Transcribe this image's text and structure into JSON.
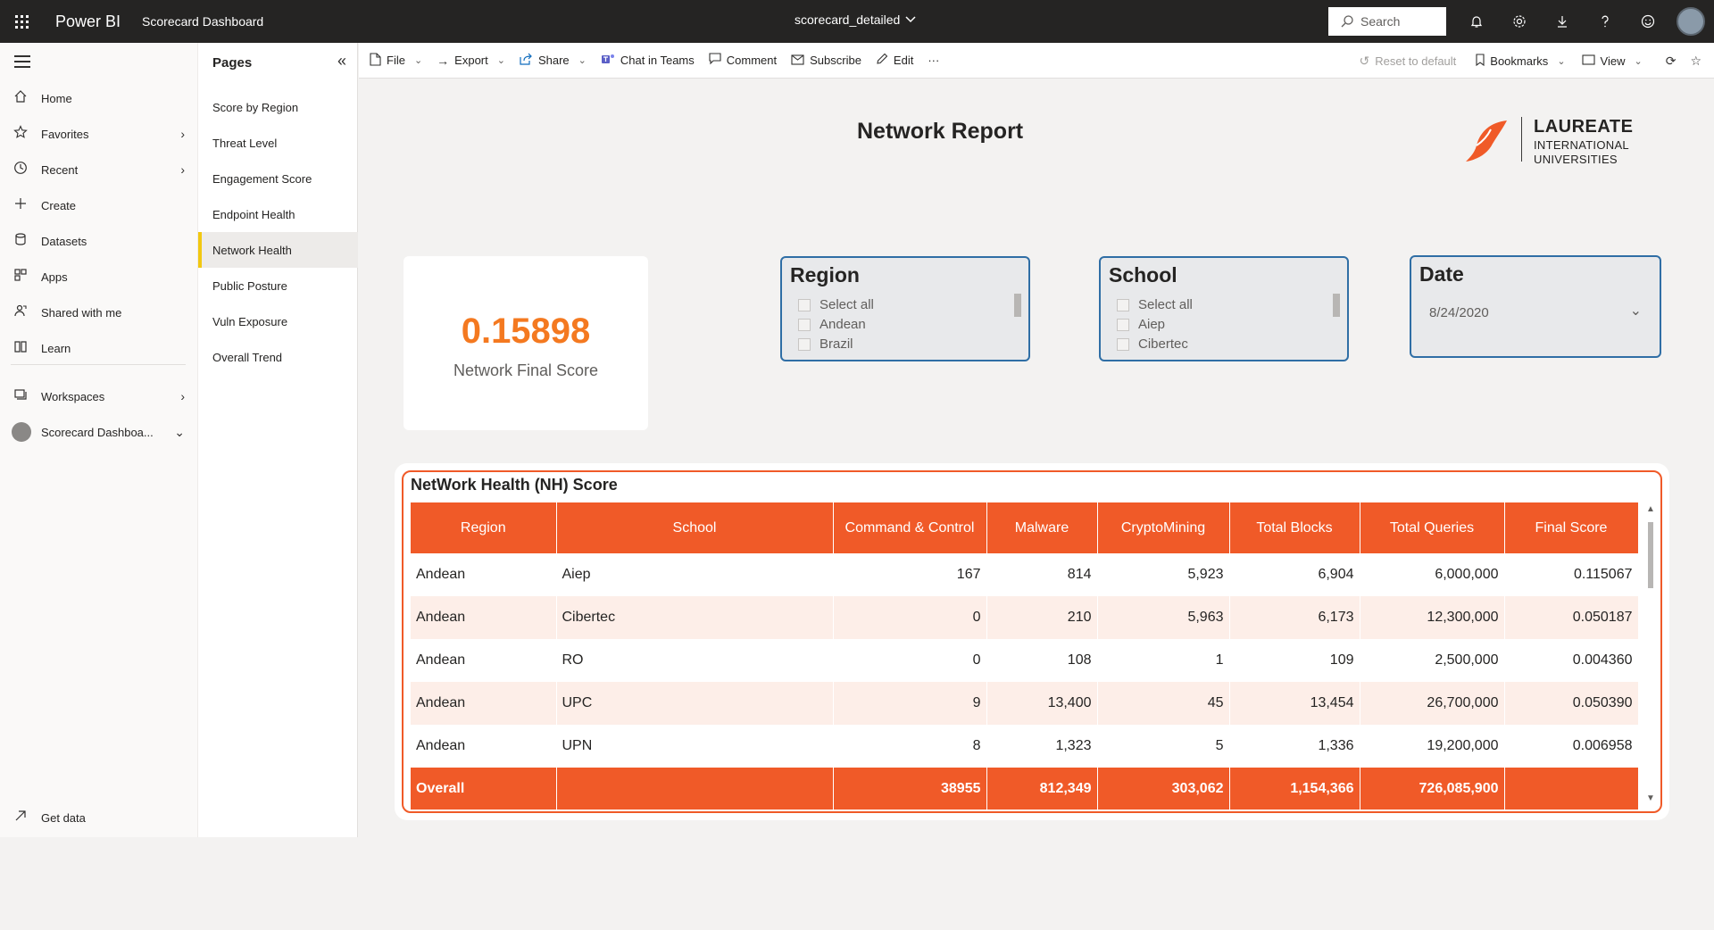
{
  "topbar": {
    "brand": "Power BI",
    "workspace": "Scorecard Dashboard",
    "report_name": "scorecard_detailed",
    "search_placeholder": "Search"
  },
  "leftnav": {
    "items": [
      {
        "label": "Home",
        "icon": "home-icon"
      },
      {
        "label": "Favorites",
        "icon": "star-icon"
      },
      {
        "label": "Recent",
        "icon": "clock-icon"
      },
      {
        "label": "Create",
        "icon": "plus-icon"
      },
      {
        "label": "Datasets",
        "icon": "database-icon"
      },
      {
        "label": "Apps",
        "icon": "apps-icon"
      },
      {
        "label": "Shared with me",
        "icon": "shared-icon"
      },
      {
        "label": "Learn",
        "icon": "book-icon"
      },
      {
        "label": "Workspaces",
        "icon": "workspaces-icon"
      },
      {
        "label": "Scorecard Dashboa...",
        "icon": "workspace-avatar"
      }
    ],
    "get_data": "Get data"
  },
  "pages": {
    "title": "Pages",
    "items": [
      "Score by Region",
      "Threat Level",
      "Engagement Score",
      "Endpoint Health",
      "Network Health",
      "Public Posture",
      "Vuln Exposure",
      "Overall Trend"
    ],
    "active": "Network Health"
  },
  "actionbar": {
    "file": "File",
    "export": "Export",
    "share": "Share",
    "chat": "Chat in Teams",
    "comment": "Comment",
    "subscribe": "Subscribe",
    "edit": "Edit",
    "more": "···",
    "reset": "Reset to default",
    "bookmarks": "Bookmarks",
    "view": "View"
  },
  "report": {
    "title": "Network Report",
    "logo": {
      "line1": "LAUREATE",
      "line2": "INTERNATIONAL",
      "line3": "UNIVERSITIES"
    },
    "kpi": {
      "value": "0.15898",
      "label": "Network Final Score"
    },
    "region_slicer": {
      "title": "Region",
      "options": [
        "Select all",
        "Andean",
        "Brazil"
      ]
    },
    "school_slicer": {
      "title": "School",
      "options": [
        "Select all",
        "Aiep",
        "Cibertec"
      ]
    },
    "date_slicer": {
      "title": "Date",
      "value": "8/24/2020"
    },
    "table": {
      "title": "NetWork Health (NH) Score",
      "columns": [
        "Region",
        "School",
        "Command & Control",
        "Malware",
        "CryptoMining",
        "Total Blocks",
        "Total Queries",
        "Final Score"
      ],
      "rows": [
        [
          "Andean",
          "Aiep",
          "167",
          "814",
          "5,923",
          "6,904",
          "6,000,000",
          "0.115067"
        ],
        [
          "Andean",
          "Cibertec",
          "0",
          "210",
          "5,963",
          "6,173",
          "12,300,000",
          "0.050187"
        ],
        [
          "Andean",
          "RO",
          "0",
          "108",
          "1",
          "109",
          "2,500,000",
          "0.004360"
        ],
        [
          "Andean",
          "UPC",
          "9",
          "13,400",
          "45",
          "13,454",
          "26,700,000",
          "0.050390"
        ],
        [
          "Andean",
          "UPN",
          "8",
          "1,323",
          "5",
          "1,336",
          "19,200,000",
          "0.006958"
        ]
      ],
      "total": [
        "Overall",
        "",
        "38955",
        "812,349",
        "303,062",
        "1,154,366",
        "726,085,900",
        ""
      ]
    }
  },
  "colors": {
    "accent": "#F05A28",
    "kpi": "#F47920",
    "slicer_border": "#2F6EA5",
    "topbar": "#252423",
    "active_page": "#F2C811"
  }
}
